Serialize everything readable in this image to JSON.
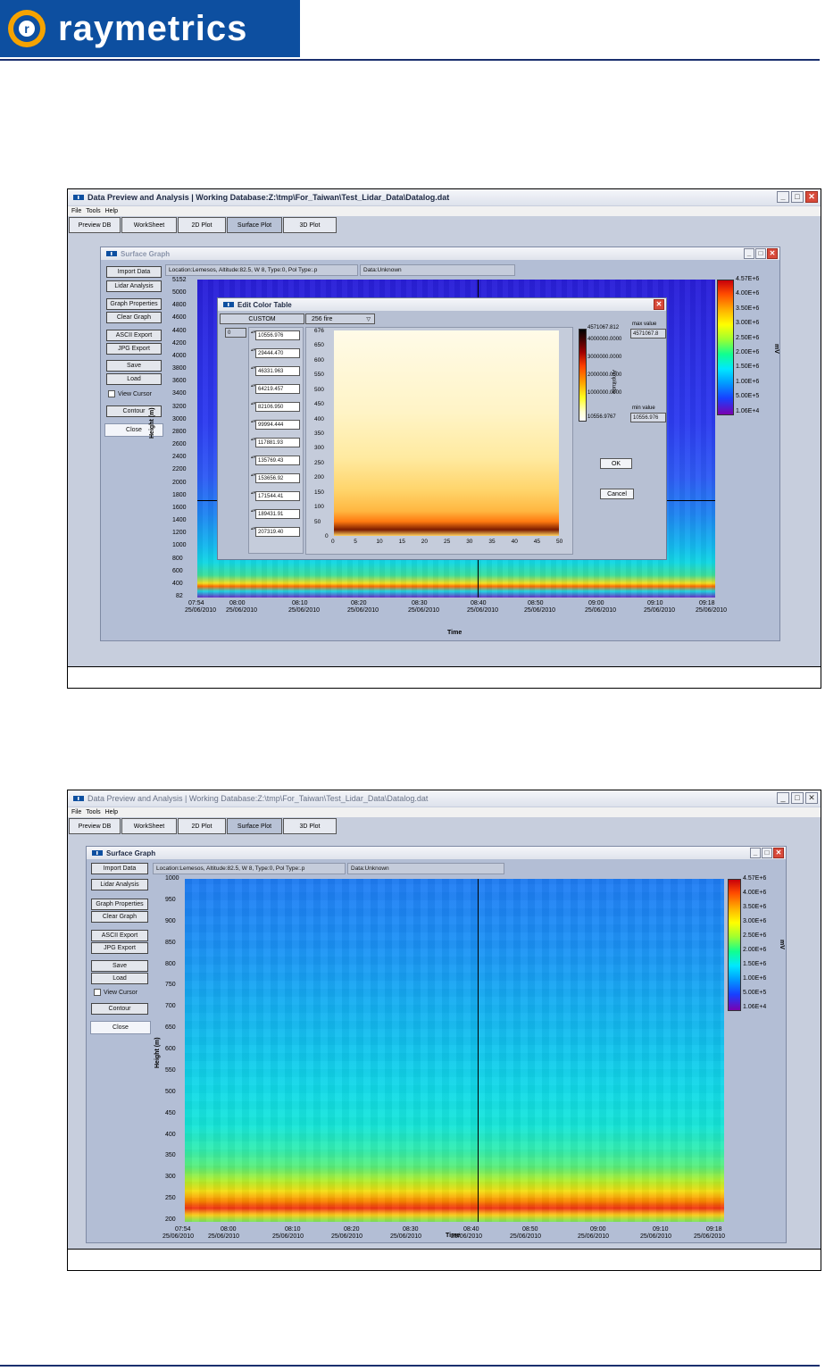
{
  "brand": {
    "name": "raymetrics",
    "mark": "r"
  },
  "app": {
    "title": "Data Preview and Analysis  |  Working Database:Z:\\tmp\\For_Taiwan\\Test_Lidar_Data\\Datalog.dat",
    "menu": [
      "File",
      "Tools",
      "Help"
    ],
    "tabs": [
      "Preview DB",
      "WorkSheet",
      "2D Plot",
      "Surface Plot",
      "3D Plot"
    ]
  },
  "surface_graph": {
    "title": "Surface Graph",
    "buttons": [
      "Import Data",
      "Lidar Analysis",
      "Graph Properties",
      "Clear Graph",
      "ASCII Export",
      "JPG Export",
      "Save",
      "Load"
    ],
    "view_cursor": "View Cursor",
    "contour": "Contour",
    "close": "Close",
    "location": "Location:Lemesos, Altitude:82.5, W 8, Type:0, Pol Type:.p",
    "data": "Data:Unknown",
    "x_title": "Time",
    "y_title": "Height (m)",
    "colorbar_unit": "mV",
    "colorbar_ticks": [
      "4.57E+6",
      "4.00E+6",
      "3.50E+6",
      "3.00E+6",
      "2.50E+6",
      "2.00E+6",
      "1.50E+6",
      "1.00E+6",
      "5.00E+5",
      "1.06E+4"
    ],
    "x_ticks": [
      {
        "t": "07:54",
        "d": "25/06/2010"
      },
      {
        "t": "08:00",
        "d": "25/06/2010"
      },
      {
        "t": "08:10",
        "d": "25/06/2010"
      },
      {
        "t": "08:20",
        "d": "25/06/2010"
      },
      {
        "t": "08:30",
        "d": "25/06/2010"
      },
      {
        "t": "08:40",
        "d": "25/06/2010"
      },
      {
        "t": "08:50",
        "d": "25/06/2010"
      },
      {
        "t": "09:00",
        "d": "25/06/2010"
      },
      {
        "t": "09:10",
        "d": "25/06/2010"
      },
      {
        "t": "09:18",
        "d": "25/06/2010"
      }
    ],
    "y_ticks_1": [
      "5152",
      "5000",
      "4800",
      "4600",
      "4400",
      "4200",
      "4000",
      "3800",
      "3600",
      "3400",
      "3200",
      "3000",
      "2800",
      "2600",
      "2400",
      "2200",
      "2000",
      "1800",
      "1600",
      "1400",
      "1200",
      "1000",
      "800",
      "600",
      "400",
      "82"
    ],
    "y_ticks_2": [
      "1000",
      "950",
      "900",
      "850",
      "800",
      "750",
      "700",
      "650",
      "600",
      "550",
      "500",
      "450",
      "400",
      "350",
      "300",
      "250",
      "200"
    ]
  },
  "edit_color_table": {
    "title": "Edit Color Table",
    "mode": "CUSTOM",
    "palette": "256 fire",
    "index": "0",
    "values": [
      "10556.976",
      "29444.470",
      "46331.963",
      "64219.457",
      "82106.950",
      "99994.444",
      "117881.93",
      "135769.43",
      "153656.92",
      "171544.41",
      "189431.91",
      "207319.40"
    ],
    "y_ticks": [
      "676",
      "650",
      "600",
      "550",
      "500",
      "450",
      "400",
      "350",
      "300",
      "250",
      "200",
      "150",
      "100",
      "50",
      "0"
    ],
    "x_ticks": [
      "0",
      "5",
      "10",
      "15",
      "20",
      "25",
      "30",
      "35",
      "40",
      "45",
      "50"
    ],
    "scale_ticks": [
      "4571067.812",
      "4000000.0000",
      "3000000.0000",
      "2000000.0000",
      "1000000.0000",
      "10556.9767"
    ],
    "scale_axis": "Amplitude",
    "max_label": "max value",
    "max_value": "4571067.8",
    "min_label": "min value",
    "min_value": "10556.976",
    "ok": "OK",
    "cancel": "Cancel"
  },
  "colors": {
    "brand_blue": "#0d4fa0",
    "brand_orange": "#f5a300",
    "rule": "#1a2f6e"
  }
}
